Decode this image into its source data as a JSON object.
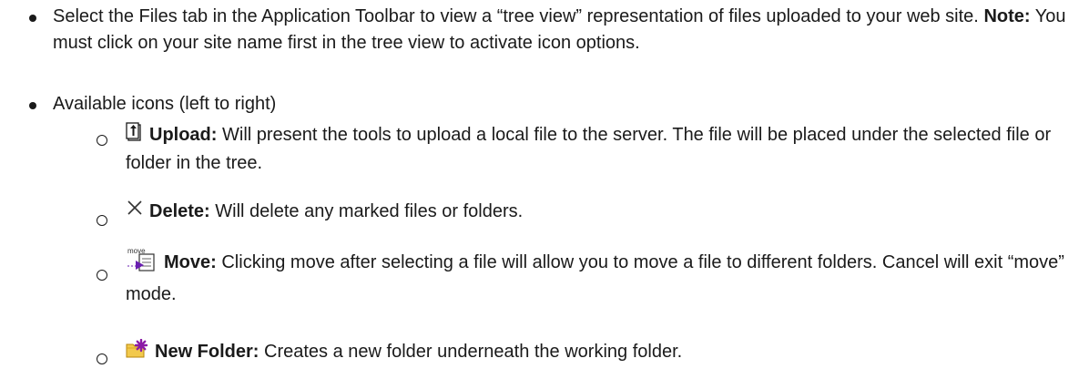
{
  "bullets": {
    "files_tab": {
      "text_before_note": "Select the Files tab in the Application Toolbar to view a “tree view” representation of files uploaded to your web site.",
      "note_label": "Note:",
      "text_after_note": "You must click on your site name first in the tree view to activate icon options."
    },
    "available_icons": {
      "text": "Available icons (left to right)"
    }
  },
  "icons": [
    {
      "icon": "upload-icon",
      "title": "Upload:",
      "description": "Will present the tools to upload a local file to the server. The file will be placed under the selected file or folder in the tree."
    },
    {
      "icon": "delete-icon",
      "title": "Delete:",
      "description": "Will delete any marked files or folders."
    },
    {
      "icon": "move-icon",
      "icon_caption": "move",
      "title": "Move:",
      "description": "Clicking move after selecting a file will allow you to move a file to different folders. Cancel will exit “move” mode."
    },
    {
      "icon": "new-folder-icon",
      "title": "New Folder:",
      "description": "Creates a new folder underneath the working folder."
    }
  ],
  "colors": {
    "text": "#1a1a1a",
    "folder": "#f2c94c",
    "star": "#8b1aa6",
    "move_arrow": "#6a1fb0",
    "upload_arrow": "#1a1a1a"
  }
}
